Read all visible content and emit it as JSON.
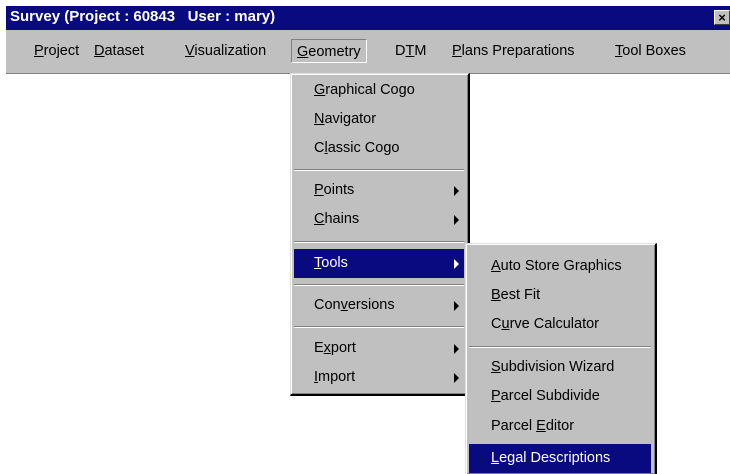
{
  "window": {
    "title": "Survey (Project : 60843   User : mary)",
    "close_label": "×"
  },
  "menubar": {
    "items": [
      {
        "label": "Project",
        "hotkey": "P"
      },
      {
        "label": "Dataset",
        "hotkey": "D"
      },
      {
        "label": "Visualization",
        "hotkey": "V"
      },
      {
        "label": "Geometry",
        "hotkey": "G",
        "open": true
      },
      {
        "label": "DTM",
        "hotkey": "T"
      },
      {
        "label": "Plans Preparations",
        "hotkey": "P"
      },
      {
        "label": "Tool Boxes",
        "hotkey": "T"
      }
    ]
  },
  "geometry_menu": {
    "items": [
      {
        "label": "Graphical Cogo",
        "hotkey": "G"
      },
      {
        "label": "Navigator",
        "hotkey": "N"
      },
      {
        "label": "Classic Cogo",
        "hotkey": "l"
      },
      {
        "label": "Points",
        "hotkey": "P",
        "submenu": true
      },
      {
        "label": "Chains",
        "hotkey": "C",
        "submenu": true
      },
      {
        "label": "Tools",
        "hotkey": "T",
        "submenu": true,
        "selected": true
      },
      {
        "label": "Conversions",
        "hotkey": "v",
        "submenu": true
      },
      {
        "label": "Export",
        "hotkey": "x",
        "submenu": true
      },
      {
        "label": "Import",
        "hotkey": "I",
        "submenu": true
      }
    ]
  },
  "tools_menu": {
    "items": [
      {
        "label": "Auto Store Graphics",
        "hotkey": "A"
      },
      {
        "label": "Best Fit",
        "hotkey": "B"
      },
      {
        "label": "Curve Calculator",
        "hotkey": "u"
      },
      {
        "label": "Subdivision Wizard",
        "hotkey": "S"
      },
      {
        "label": "Parcel Subdivide",
        "hotkey": "P"
      },
      {
        "label": "Parcel Editor",
        "hotkey": "E"
      },
      {
        "label": "Legal Descriptions",
        "hotkey": "L",
        "selected": true
      }
    ]
  }
}
